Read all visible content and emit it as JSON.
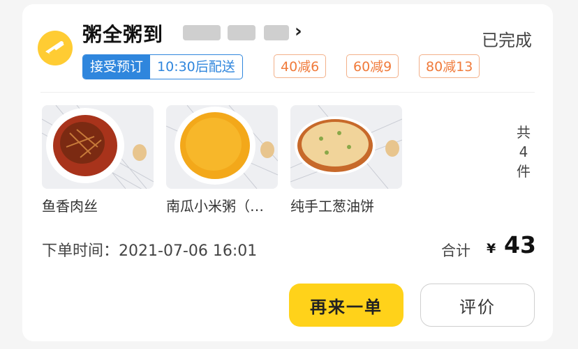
{
  "order": {
    "shop_name": "粥全粥到",
    "status": "已完成",
    "tags": {
      "reservation": "接受预订",
      "delivery_time": "10:30后配送"
    },
    "discounts": [
      "40减6",
      "60减9",
      "80减13"
    ],
    "items": [
      {
        "name": "鱼香肉丝"
      },
      {
        "name": "南瓜小米粥（…"
      },
      {
        "name": "纯手工葱油饼"
      }
    ],
    "count_lines": [
      "共",
      "4",
      "件"
    ],
    "order_time_label": "下单时间：",
    "order_time": "2021-07-06 16:01",
    "total_label": "合计",
    "currency": "¥",
    "total_value": "43",
    "buttons": {
      "reorder": "再来一单",
      "review": "评价"
    }
  },
  "colors": {
    "accent_yellow": "#ffd21a",
    "tag_blue": "#2f86dd",
    "discount_orange": "#f07a3a"
  },
  "icons": [
    "delivery-logo-icon",
    "chevron-right-icon"
  ]
}
